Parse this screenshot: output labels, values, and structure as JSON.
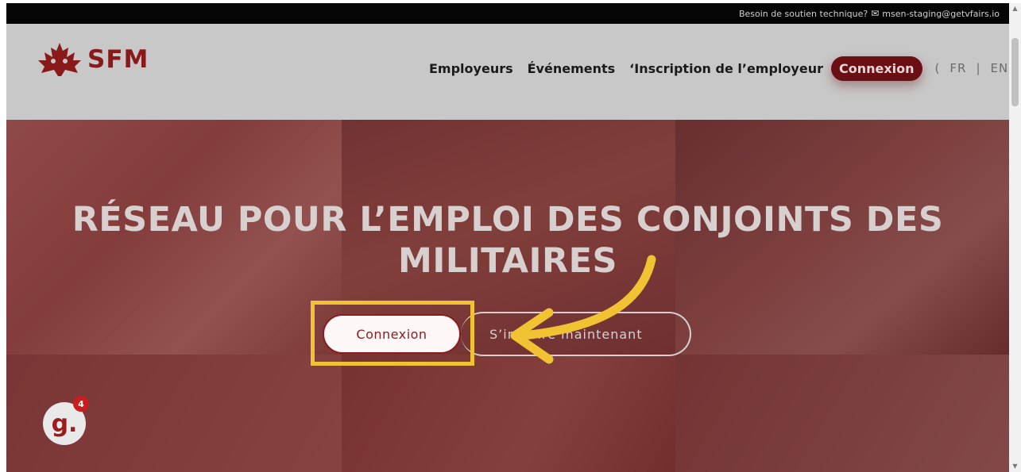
{
  "topbar": {
    "support_text": "Besoin de soutien technique?",
    "email": "msen-staging@getvfairs.io"
  },
  "header": {
    "logo_text": "SFM",
    "nav": [
      "Employeurs",
      "Événements",
      "‘Inscription de l’employeur"
    ],
    "connexion_label": "Connexion",
    "lang": {
      "open": "(",
      "fr": "FR",
      "sep": "|",
      "en": "EN",
      "close": ")"
    }
  },
  "hero": {
    "title_line1": "RÉSEAU POUR L’EMPLOI DES CONJOINTS DES",
    "title_line2": "MILITAIRES",
    "connexion_button": "Connexion",
    "signup_button": "S’inscrire maintenant"
  },
  "badge": {
    "letter": "g.",
    "count": "4"
  },
  "colors": {
    "brand": "#8b1c1c",
    "highlight": "#f1c232",
    "topbar": "#050505"
  }
}
